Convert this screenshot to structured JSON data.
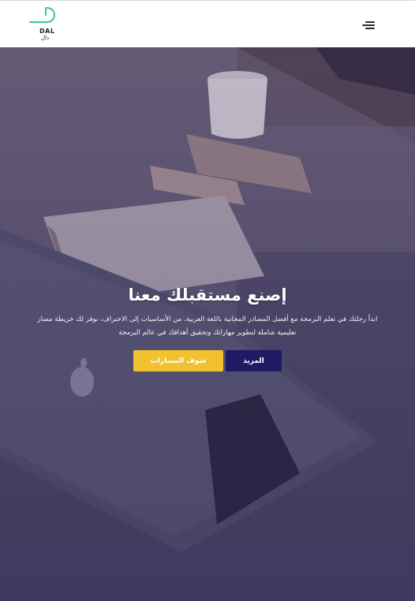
{
  "header": {
    "logo": {
      "name_en": "DAL",
      "name_ar": "دال",
      "accent": "#4cc3b0"
    },
    "menu_icon": "hamburger-menu-icon"
  },
  "hero": {
    "title": "إصنع مستقبلك معنا",
    "description_line1": "ابدأ رحلتك في تعلم البرمجة مع أفضل المصادر المجانية باللغة العربية. من الأساسيات إلى الاحتراف، نوفر لك خريطة مسار",
    "description_line2": "تعليمية شاملة لتطوير مهاراتك وتحقيق أهدافك في عالم البرمجة",
    "primary_button": "شوف المسارات",
    "secondary_button": "المزيد",
    "colors": {
      "primary": "#f2c12e",
      "secondary": "#1f1a63"
    }
  }
}
